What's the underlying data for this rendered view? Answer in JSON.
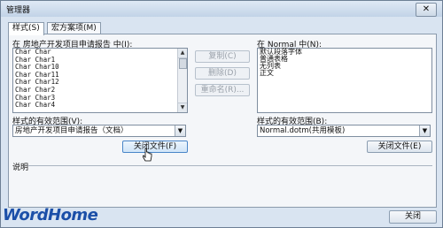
{
  "window": {
    "title": "管理器",
    "close_glyph": "✕"
  },
  "tabs": [
    {
      "label": "样式(S)"
    },
    {
      "label": "宏方案项(M)"
    }
  ],
  "left": {
    "in_label": "在 房地产开发项目申请报告 中(I):",
    "items": [
      "Char Char",
      "Char Char1",
      "Char Char10",
      "Char Char11",
      "Char Char12",
      "Char Char2",
      "Char Char3",
      "Char Char4"
    ],
    "scope_label": "样式的有效范围(V):",
    "scope_value": "房地产开发项目申请报告（文档）",
    "close_file": "关闭文件(F)"
  },
  "middle": {
    "copy": "复制(C)",
    "delete": "删除(D)",
    "rename": "重命名(R)..."
  },
  "right": {
    "in_label": "在 Normal 中(N):",
    "items": [
      "默认段落字体",
      "普通表格",
      "无列表",
      "正文"
    ],
    "scope_label": "样式的有效范围(B):",
    "scope_value": "Normal.dotm(共用模板)",
    "close_file": "关闭文件(E)"
  },
  "description_label": "说明",
  "logo_text": "WordHome",
  "footer": {
    "close": "关闭"
  }
}
